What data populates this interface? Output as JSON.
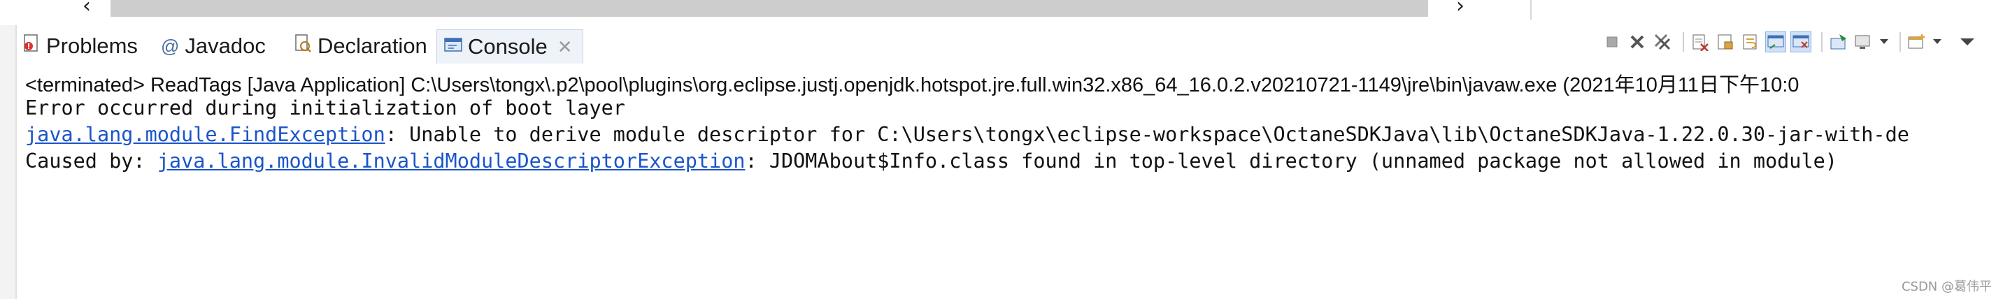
{
  "tabs": [
    {
      "label": "Problems",
      "icon": "problems-icon"
    },
    {
      "label": "Javadoc",
      "icon": "javadoc-icon",
      "glyph": "@"
    },
    {
      "label": "Declaration",
      "icon": "declaration-icon"
    },
    {
      "label": "Console",
      "icon": "console-icon",
      "close": "✕"
    }
  ],
  "toolbar": {
    "icons": [
      "terminate-icon",
      "remove-launch-icon",
      "remove-all-terminated-icon",
      "clear-console-icon",
      "scroll-lock-icon",
      "word-wrap-icon",
      "show-console-on-stdout-icon",
      "show-console-on-stderr-icon",
      "pin-console-icon",
      "display-selected-console-icon",
      "open-console-icon",
      "view-menu-icon"
    ]
  },
  "console": {
    "process_line": "<terminated> ReadTags [Java Application] C:\\Users\\tongx\\.p2\\pool\\plugins\\org.eclipse.justj.openjdk.hotspot.jre.full.win32.x86_64_16.0.2.v20210721-1149\\jre\\bin\\javaw.exe  (2021年10月11日下午10:0",
    "line1": "Error occurred during initialization of boot layer",
    "line2_link": "java.lang.module.FindException",
    "line2_rest": ": Unable to derive module descriptor for C:\\Users\\tongx\\eclipse-workspace\\OctaneSDKJava\\lib\\OctaneSDKJava-1.22.0.30-jar-with-de",
    "line3_prefix": "Caused by: ",
    "line3_link": "java.lang.module.InvalidModuleDescriptorException",
    "line3_rest": ": JDOMAbout$Info.class found in top-level directory (unnamed package not allowed in module)"
  },
  "scroll": {
    "left_arrow": "‹",
    "right_arrow": "›"
  },
  "watermark": "CSDN @葛伟平"
}
